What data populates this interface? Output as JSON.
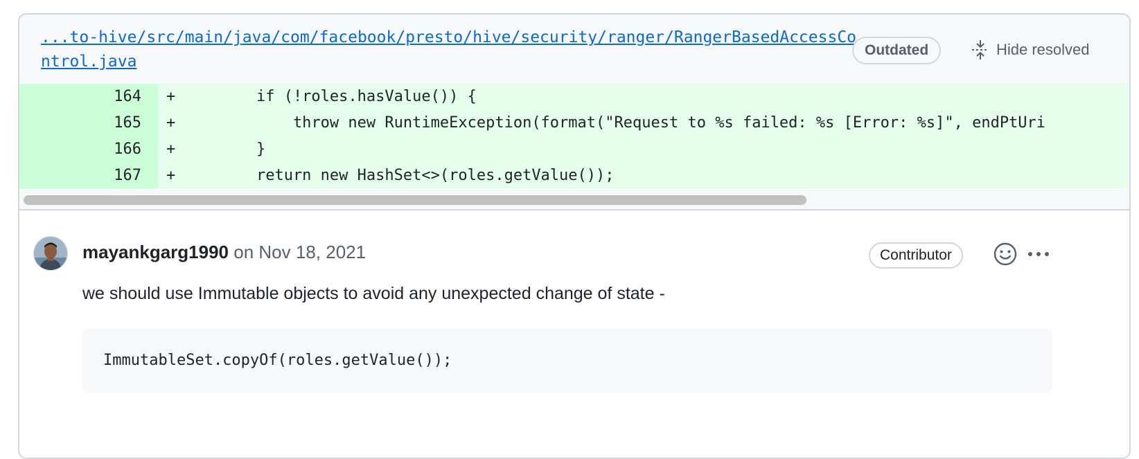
{
  "file_header": {
    "path": "...to-hive/src/main/java/com/facebook/presto/hive/security/ranger/RangerBasedAccessControl.java",
    "outdated_label": "Outdated",
    "hide_resolved_label": "Hide resolved"
  },
  "diff": {
    "lines": [
      {
        "number": "164",
        "marker": "+",
        "code": "        if (!roles.hasValue()) {"
      },
      {
        "number": "165",
        "marker": "+",
        "code": "            throw new RuntimeException(format(\"Request to %s failed: %s [Error: %s]\", endPtUri"
      },
      {
        "number": "166",
        "marker": "+",
        "code": "        }"
      },
      {
        "number": "167",
        "marker": "+",
        "code": "        return new HashSet<>(roles.getValue());"
      }
    ]
  },
  "comment": {
    "author": "mayankgarg1990",
    "date": "on Nov 18, 2021",
    "role_badge": "Contributor",
    "body": "we should use Immutable objects to avoid any unexpected change of state -",
    "code": "ImmutableSet.copyOf(roles.getValue());",
    "icons": {
      "reaction": "smiley-icon",
      "more": "kebab-horizontal-icon",
      "hide_resolved": "fold-icon",
      "avatar": "user-avatar"
    }
  },
  "colors": {
    "link": "#0969da",
    "diff_added_bg": "#e6ffec",
    "diff_added_num_bg": "#ccffd8",
    "header_bg": "#f6f8fa",
    "border": "#d0d7de",
    "muted_text": "#57606a"
  }
}
